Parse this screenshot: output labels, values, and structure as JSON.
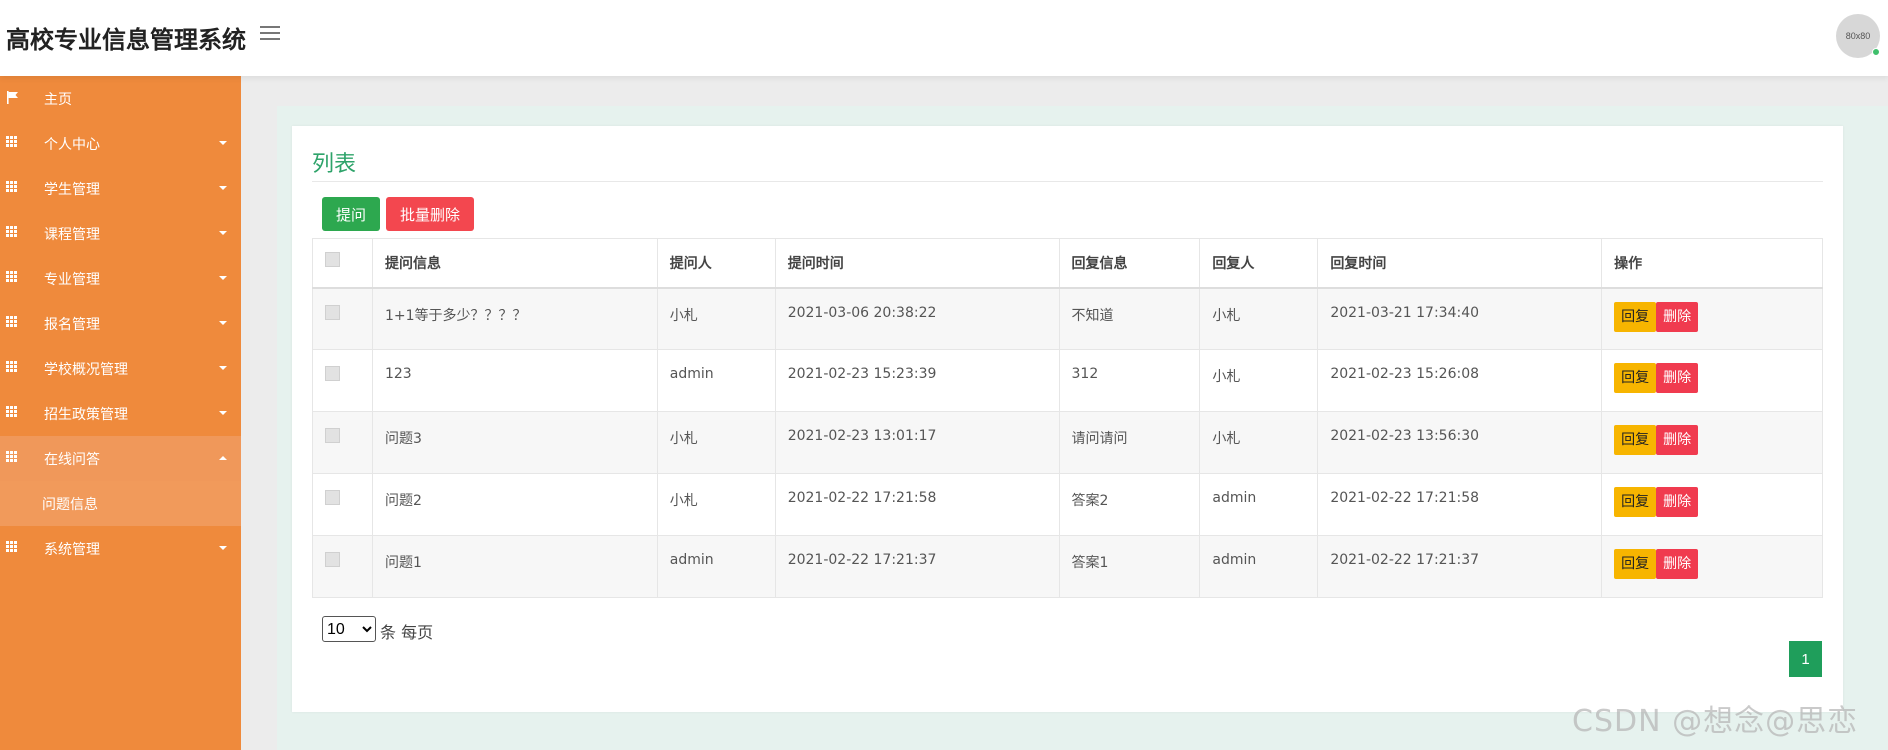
{
  "header": {
    "app_title": "高校专业信息管理系统",
    "avatar_text": "80x80"
  },
  "sidebar": {
    "items": [
      {
        "label": "主页",
        "icon": "flag-icon"
      },
      {
        "label": "个人中心",
        "icon": "grid-icon"
      },
      {
        "label": "学生管理",
        "icon": "grid-icon"
      },
      {
        "label": "课程管理",
        "icon": "grid-icon"
      },
      {
        "label": "专业管理",
        "icon": "grid-icon"
      },
      {
        "label": "报名管理",
        "icon": "grid-icon"
      },
      {
        "label": "学校概况管理",
        "icon": "grid-icon"
      },
      {
        "label": "招生政策管理",
        "icon": "grid-icon"
      },
      {
        "label": "在线问答",
        "icon": "grid-icon"
      },
      {
        "label": "系统管理",
        "icon": "grid-icon"
      }
    ],
    "sub_item": "问题信息"
  },
  "card": {
    "title": "列表",
    "ask_label": "提问",
    "batch_delete_label": "批量删除"
  },
  "table": {
    "headers": [
      "提问信息",
      "提问人",
      "提问时间",
      "回复信息",
      "回复人",
      "回复时间",
      "操作"
    ],
    "rows": [
      [
        "1+1等于多少？？？？",
        "小札",
        "2021-03-06 20:38:22",
        "不知道",
        "小札",
        "2021-03-21 17:34:40"
      ],
      [
        "123",
        "admin",
        "2021-02-23 15:23:39",
        "312",
        "小札",
        "2021-02-23 15:26:08"
      ],
      [
        "问题3",
        "小札",
        "2021-02-23 13:01:17",
        "请问请问",
        "小札",
        "2021-02-23 13:56:30"
      ],
      [
        "问题2",
        "小札",
        "2021-02-22 17:21:58",
        "答案2",
        "admin",
        "2021-02-22 17:21:58"
      ],
      [
        "问题1",
        "admin",
        "2021-02-22 17:21:37",
        "答案1",
        "admin",
        "2021-02-22 17:21:37"
      ]
    ],
    "reply_label": "回复",
    "delete_label": "删除"
  },
  "pagination": {
    "page_size": "10",
    "page_size_options": [
      "10"
    ],
    "page_size_suffix": "条 每页",
    "current_page": "1"
  },
  "watermark": "CSDN @想念@思恋",
  "colors": {
    "sidebar": "#ef8a3c",
    "accent_green": "#2ea36a",
    "danger": "#f03b4f",
    "warning": "#f7b500"
  }
}
